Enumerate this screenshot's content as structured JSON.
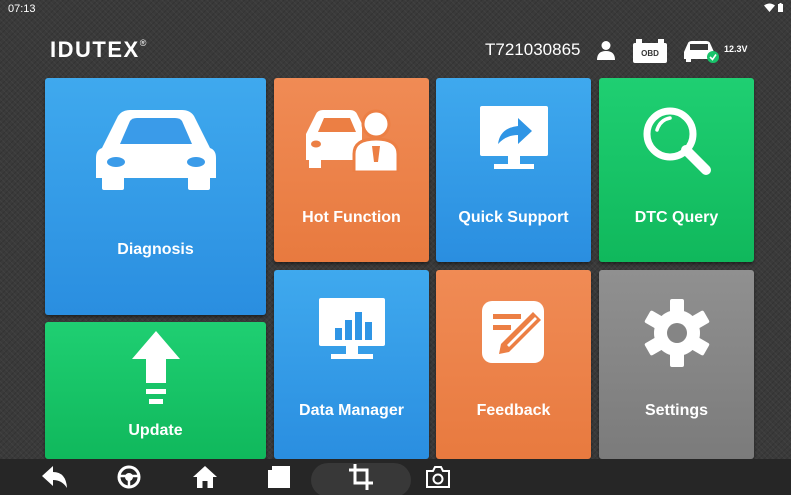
{
  "status_bar": {
    "time": "07:13",
    "wifi_icon": "wifi-icon",
    "battery_icon": "battery-icon"
  },
  "header": {
    "brand": "IDUTEX",
    "brand_mark": "®",
    "serial": "T721030865",
    "user_icon": "user-icon",
    "obd_icon": "obd-connector-icon",
    "obd_label": "OBD",
    "car_status_icon": "car-connected-icon",
    "voltage": "12.3V"
  },
  "tiles": [
    {
      "label": "Diagnosis",
      "icon": "car-icon",
      "color": "#2f95e5"
    },
    {
      "label": "Hot Function",
      "icon": "mechanic-car-icon",
      "color": "#ec7f44"
    },
    {
      "label": "Quick Support",
      "icon": "remote-support-monitor-icon",
      "color": "#2f95e5"
    },
    {
      "label": "DTC Query",
      "icon": "magnifier-icon",
      "color": "#16c365"
    },
    {
      "label": "Update",
      "icon": "upload-arrow-icon",
      "color": "#16c365"
    },
    {
      "label": "Data Manager",
      "icon": "bar-chart-monitor-icon",
      "color": "#2f95e5"
    },
    {
      "label": "Feedback",
      "icon": "edit-note-icon",
      "color": "#ec7f44"
    },
    {
      "label": "Settings",
      "icon": "gear-icon",
      "color": "#858585"
    }
  ],
  "navbar": {
    "buttons": [
      "back-icon",
      "steering-wheel-icon",
      "home-icon",
      "recent-apps-icon",
      "crop-screenshot-icon",
      "camera-icon"
    ]
  }
}
